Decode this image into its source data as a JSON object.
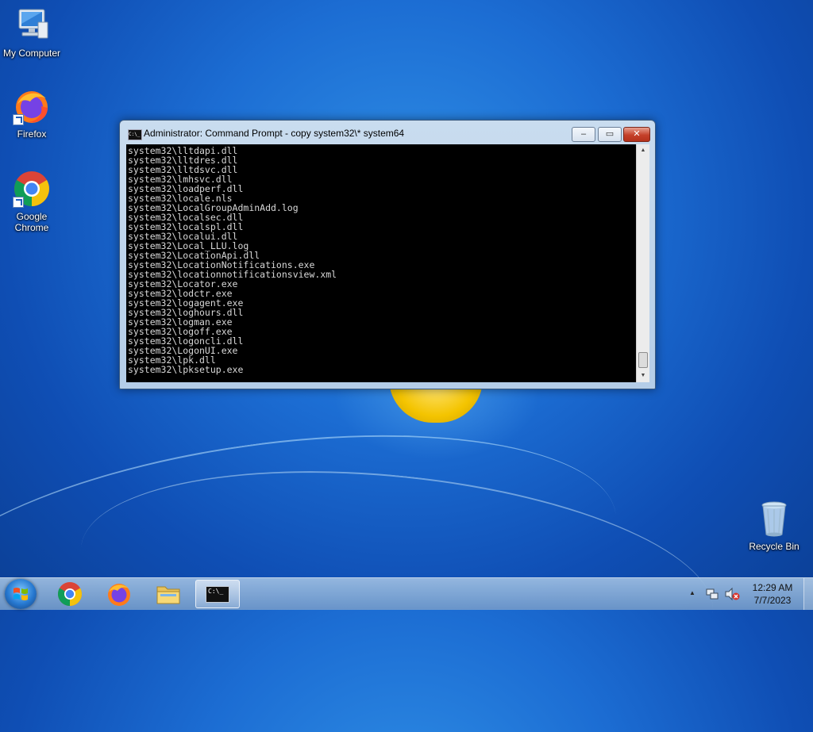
{
  "desktop": {
    "icons": [
      {
        "label": "My Computer"
      },
      {
        "label": "Firefox"
      },
      {
        "label": "Google Chrome"
      },
      {
        "label": "Recycle Bin"
      }
    ]
  },
  "window": {
    "title": "Administrator:  Command Prompt - copy  system32\\* system64",
    "console_icon_text": "C:\\_",
    "lines": [
      "system32\\lltdapi.dll",
      "system32\\lltdres.dll",
      "system32\\lltdsvc.dll",
      "system32\\lmhsvc.dll",
      "system32\\loadperf.dll",
      "system32\\locale.nls",
      "system32\\LocalGroupAdminAdd.log",
      "system32\\localsec.dll",
      "system32\\localspl.dll",
      "system32\\localui.dll",
      "system32\\Local_LLU.log",
      "system32\\LocationApi.dll",
      "system32\\LocationNotifications.exe",
      "system32\\locationnotificationsview.xml",
      "system32\\Locator.exe",
      "system32\\lodctr.exe",
      "system32\\logagent.exe",
      "system32\\loghours.dll",
      "system32\\logman.exe",
      "system32\\logoff.exe",
      "system32\\logoncli.dll",
      "system32\\LogonUI.exe",
      "system32\\lpk.dll",
      "system32\\lpksetup.exe"
    ],
    "controls": {
      "minimize": "–",
      "maximize": "▭",
      "close": "✕"
    }
  },
  "taskbar": {
    "clock_time": "12:29 AM",
    "clock_date": "7/7/2023",
    "tray_arrow": "▲",
    "cmd_button_text": "C:\\_"
  },
  "colors": {
    "console_bg": "#000000",
    "console_text": "#d8d8d8",
    "close_red": "#c4402a"
  }
}
